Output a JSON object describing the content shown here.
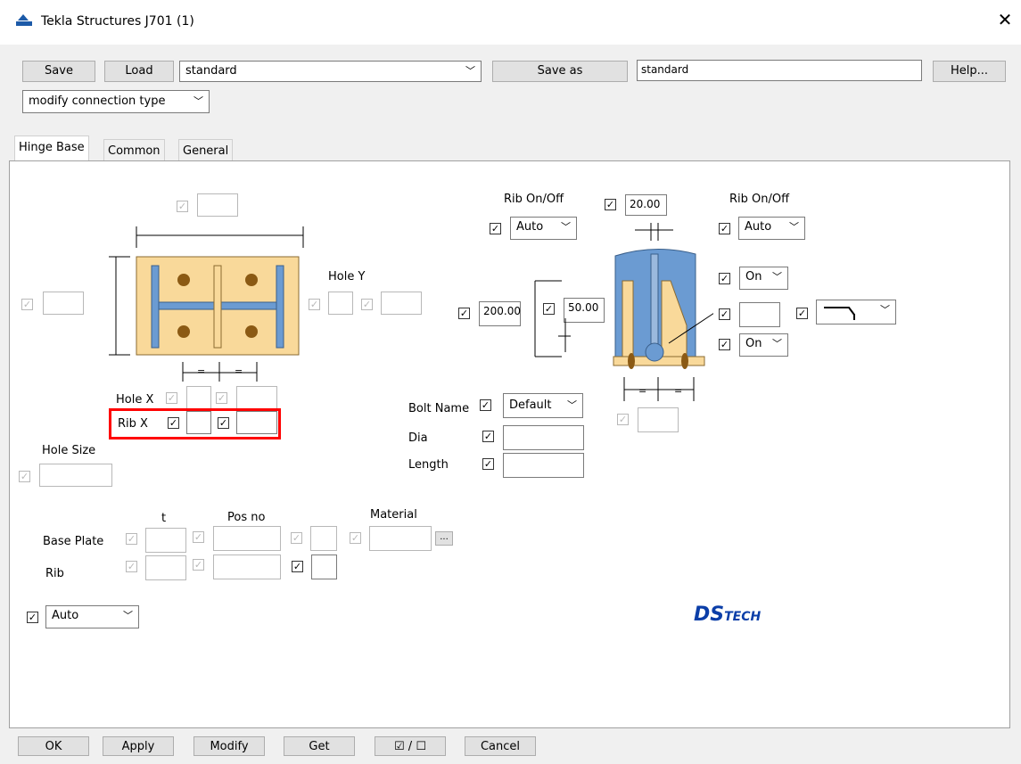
{
  "window": {
    "title": "Tekla Structures  J701 (1)"
  },
  "toolbar": {
    "save_label": "Save",
    "load_label": "Load",
    "preset_value": "standard",
    "save_as_label": "Save as",
    "save_as_value": "standard",
    "help_label": "Help...",
    "mode_value": "modify connection type"
  },
  "tabs": [
    "Hinge Base",
    "Common",
    "General"
  ],
  "hinge_base": {
    "hole_y_label": "Hole Y",
    "hole_x_label": "Hole X",
    "rib_x_label": "Rib X",
    "hole_size_label": "Hole Size",
    "rib_onoff_left_label": "Rib On/Off",
    "rib_onoff_right_label": "Rib On/Off",
    "rib_left_value": "Auto",
    "rib_right_value": "Auto",
    "rib_gap_value": "20.00",
    "rib_height_value": "200.00",
    "rib_offset_value": "50.00",
    "on1_value": "On",
    "on2_value": "On",
    "bolt_name_label": "Bolt Name",
    "bolt_name_value": "Default",
    "dia_label": "Dia",
    "length_label": "Length",
    "t_label": "t",
    "pos_no_label": "Pos no",
    "material_label": "Material",
    "base_plate_label": "Base Plate",
    "rib_label": "Rib",
    "ellipsis_label": "...",
    "bottom_combo_value": "Auto",
    "eq_symbol": "="
  },
  "logo": {
    "text_ds": "DS",
    "text_tech": "TECH"
  },
  "footer": {
    "ok_label": "OK",
    "apply_label": "Apply",
    "modify_label": "Modify",
    "get_label": "Get",
    "toggle_label": "☑ / ☐",
    "cancel_label": "Cancel"
  }
}
